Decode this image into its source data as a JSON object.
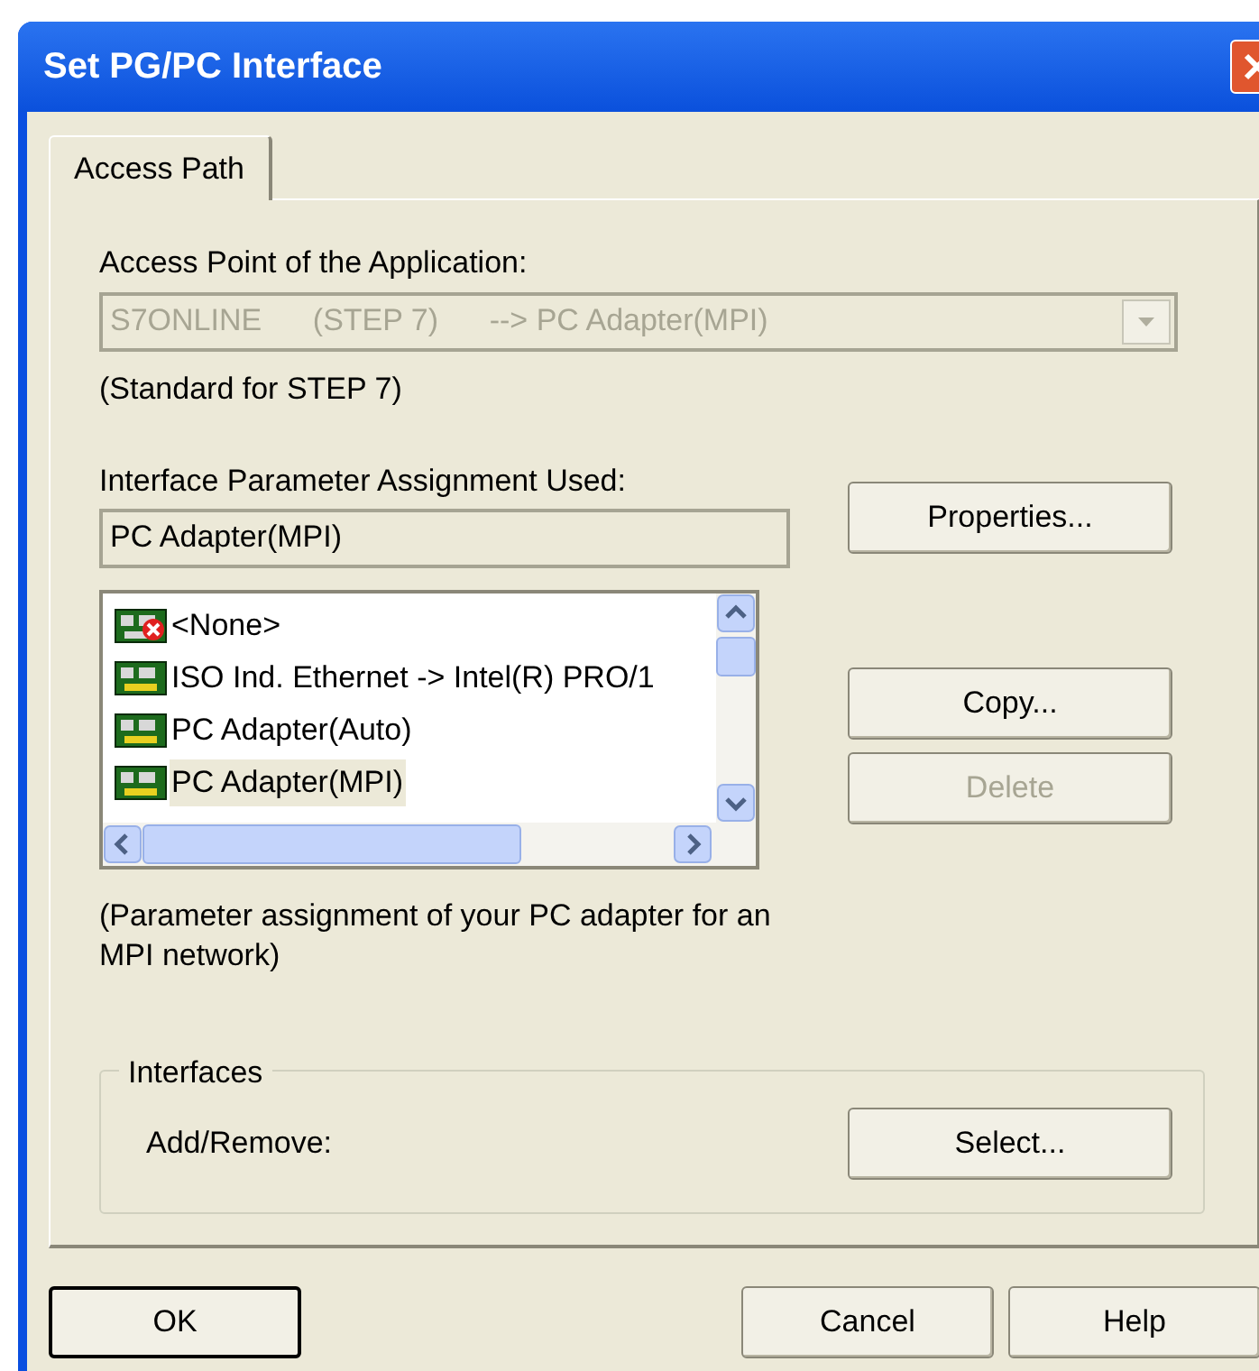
{
  "window": {
    "title": "Set PG/PC Interface"
  },
  "tabs": [
    {
      "label": "Access Path",
      "selected": true
    }
  ],
  "access_point": {
    "label": "Access Point of the Application:",
    "value": "S7ONLINE      (STEP 7)      --> PC Adapter(MPI)",
    "disabled": true,
    "note": "(Standard for STEP 7)"
  },
  "assignment": {
    "label": "Interface Parameter Assignment Used:",
    "value": "PC Adapter(MPI)"
  },
  "list": [
    {
      "label": "<None>",
      "kind": "none",
      "selected": false
    },
    {
      "label": "ISO Ind. Ethernet -> Intel(R) PRO/1",
      "kind": "adapter",
      "selected": false
    },
    {
      "label": "PC Adapter(Auto)",
      "kind": "adapter",
      "selected": false
    },
    {
      "label": "PC Adapter(MPI)",
      "kind": "adapter",
      "selected": true
    }
  ],
  "side_buttons": [
    {
      "label": "Properties...",
      "disabled": false
    },
    {
      "label": "Copy...",
      "disabled": false
    },
    {
      "label": "Delete",
      "disabled": true
    }
  ],
  "description": "(Parameter assignment of your PC adapter for an MPI network)",
  "interfaces": {
    "title": "Interfaces",
    "label": "Add/Remove:",
    "button": "Select..."
  },
  "buttons": [
    {
      "label": "OK",
      "default": true
    },
    {
      "label": "Cancel",
      "default": false
    },
    {
      "label": "Help",
      "default": false
    }
  ]
}
